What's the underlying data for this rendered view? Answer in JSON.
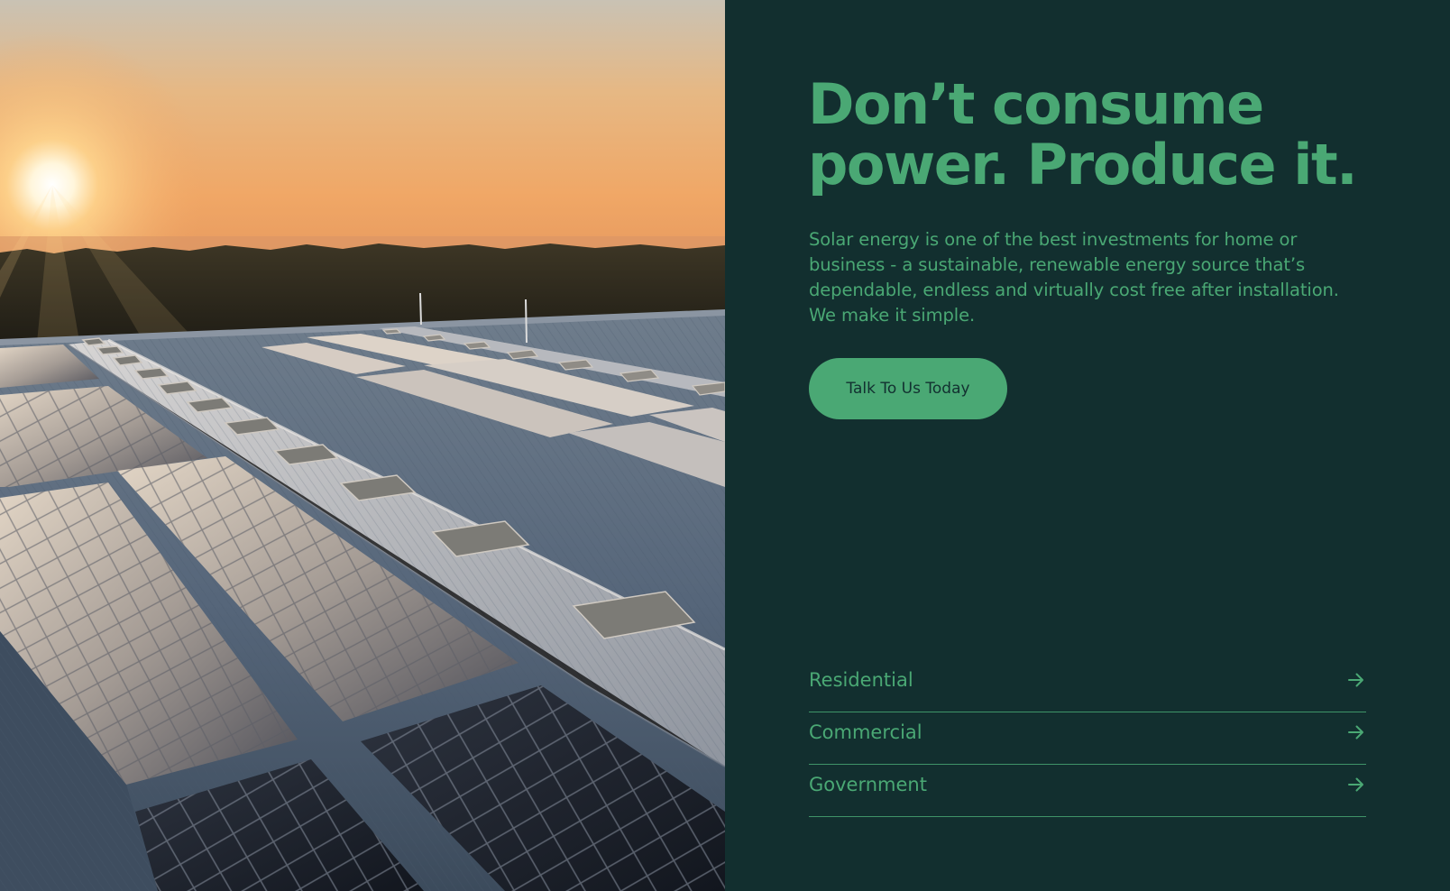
{
  "hero": {
    "image_icon": "solar-rooftop-sunset-photo",
    "headline_line1": "Don’t consume",
    "headline_line2": "power. Produce it.",
    "intro": "Solar energy is one of the best investments for home or business - a sustainable, renewable energy source that’s dependable, endless and virtually cost free after installation. We make it simple.",
    "cta_label": "Talk To Us Today"
  },
  "sectors": [
    {
      "label": "Residential",
      "icon": "arrow-right-icon"
    },
    {
      "label": "Commercial",
      "icon": "arrow-right-icon"
    },
    {
      "label": "Government",
      "icon": "arrow-right-icon"
    }
  ],
  "colors": {
    "panel_background": "#122f2f",
    "accent_green": "#4aa874",
    "button_text": "#123030"
  }
}
